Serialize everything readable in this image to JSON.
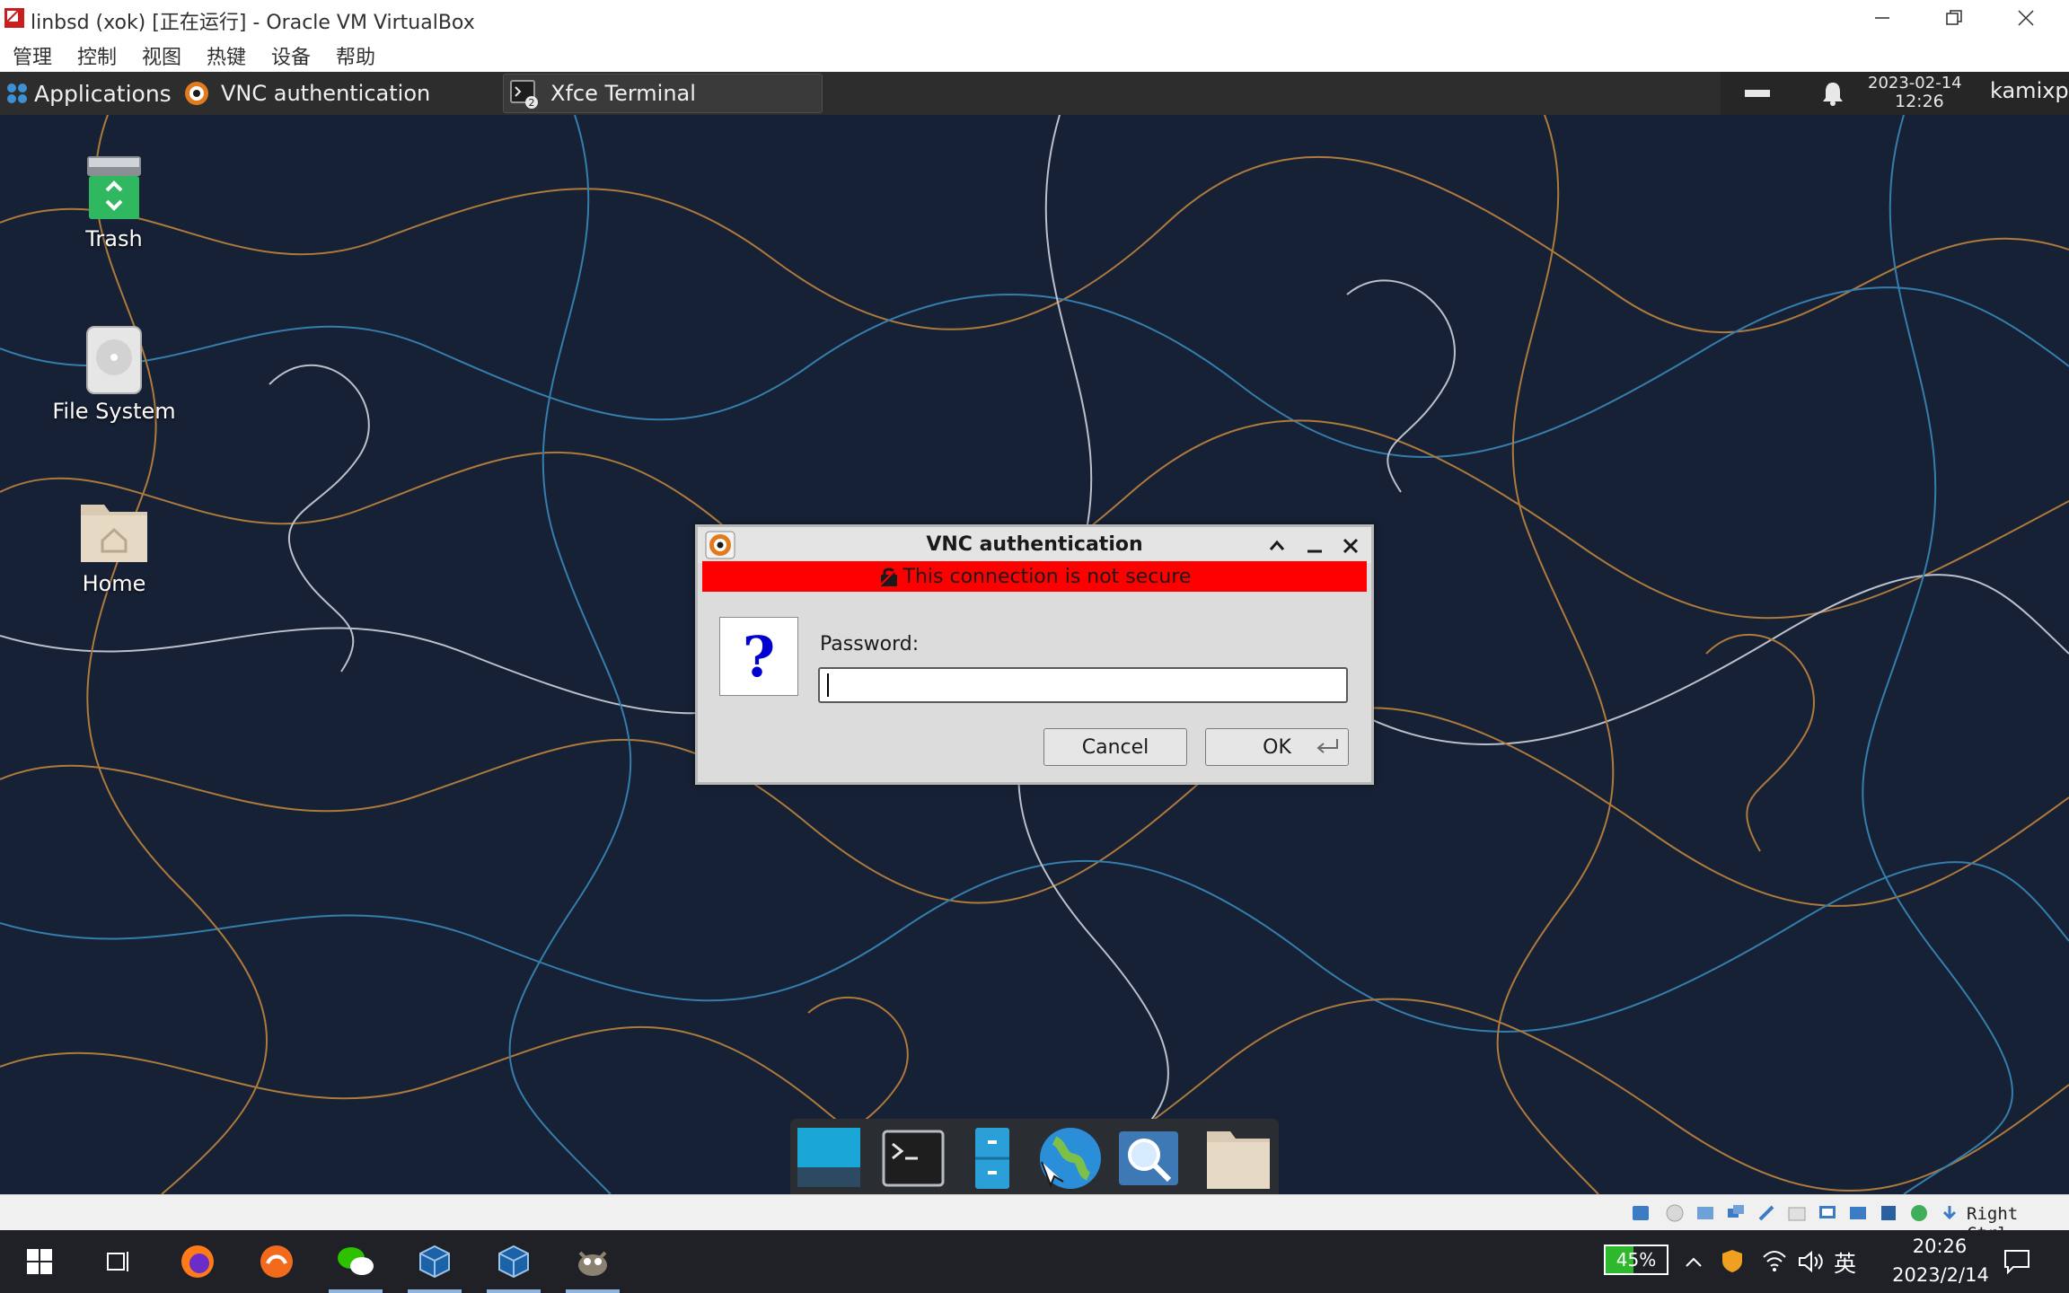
{
  "vbox": {
    "title": "linbsd (xok) [正在运行] - Oracle VM VirtualBox",
    "menu": [
      "管理",
      "控制",
      "视图",
      "热键",
      "设备",
      "帮助"
    ],
    "host_key": "Right Ctrl"
  },
  "panel": {
    "applications_label": "Applications",
    "tasks": [
      {
        "label": "VNC authentication"
      },
      {
        "label": "Xfce Terminal",
        "badge": "2"
      }
    ],
    "clock_date": "2023-02-14",
    "clock_time": "12:26",
    "user": "kamixp"
  },
  "desktop": {
    "icons": [
      {
        "label": "Trash"
      },
      {
        "label": "File System"
      },
      {
        "label": "Home"
      }
    ]
  },
  "dialog": {
    "title": "VNC authentication",
    "warning": "This connection is not secure",
    "question_symbol": "?",
    "password_label": "Password:",
    "password_value": "",
    "cancel_label": "Cancel",
    "ok_label": "OK"
  },
  "win_taskbar": {
    "battery_percent": "45%",
    "battery_level": 0.45,
    "ime": "英",
    "time": "20:26",
    "date": "2023/2/14"
  },
  "colors": {
    "wallpaper": "#172135",
    "panel": "#2d2d2d",
    "warning": "#ff0000",
    "question": "#0000d0",
    "taskbar": "#1f2126"
  }
}
